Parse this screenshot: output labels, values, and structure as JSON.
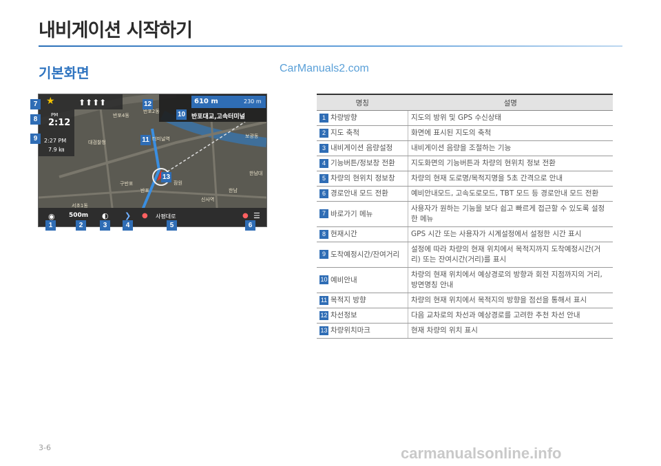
{
  "page": {
    "title": "내비게이션 시작하기",
    "section": "기본화면",
    "watermark_top": "CarManuals2.com",
    "page_number": "3-6",
    "watermark_bottom": "carmanualsonline.info"
  },
  "map": {
    "turn_distance": "610 m",
    "next_distance": "230 m",
    "guide_name": "반포대교,고속터미널",
    "time_pm": "PM",
    "current_time": "2:12",
    "arrival_time": "2:27 PM",
    "remaining_distance": "7.9 ㎞",
    "scale": "500m",
    "road_name": "사평대로",
    "labels": [
      "반포4동",
      "반포2동",
      "터미널역",
      "대검찰청",
      "구반포",
      "반포",
      "신사역",
      "한남",
      "한남대",
      "보광동",
      "서초1동",
      "잠원"
    ]
  },
  "callouts": [
    "1",
    "2",
    "3",
    "4",
    "5",
    "6",
    "7",
    "8",
    "9",
    "10",
    "11",
    "12",
    "13"
  ],
  "table": {
    "header": [
      "명칭",
      "설명"
    ],
    "rows": [
      {
        "num": "1",
        "name": "차량방향",
        "desc": "지도의 방위 및 GPS 수신상태"
      },
      {
        "num": "2",
        "name": "지도 축척",
        "desc": "화면에 표시된 지도의 축척"
      },
      {
        "num": "3",
        "name": "내비게이션 음량설정",
        "desc": "내비게이션 음량을 조절하는 기능"
      },
      {
        "num": "4",
        "name": "기능버튼/정보창 전환",
        "desc": "지도화면의 기능버튼과 차량의 현위치 정보 전환"
      },
      {
        "num": "5",
        "name": "차량의 현위치 정보창",
        "desc": "차량의 현재 도로명/목적지명을 5초 간격으로 안내"
      },
      {
        "num": "6",
        "name": "경로안내 모드 전환",
        "desc": "예비안내모드, 고속도로모드, TBT 모드 등 경로안내 모드 전환"
      },
      {
        "num": "7",
        "name": "바로가기 메뉴",
        "desc": "사용자가 원하는 기능을 보다 쉽고 빠르게 접근할 수 있도록 설정한 메뉴"
      },
      {
        "num": "8",
        "name": "현재시간",
        "desc": "GPS 시간 또는 사용자가 시계설정에서 설정한 시간 표시"
      },
      {
        "num": "9",
        "name": "도착예정시간/잔여거리",
        "desc": "설정에 따라 차량의 현재 위치에서 목적지까지 도착예정시간(거리) 또는 잔여시간(거리)를 표시"
      },
      {
        "num": "10",
        "name": "예비안내",
        "desc": "차량의 현재 위치에서 예상경로의 방향과 회전 지점까지의 거리, 방면명칭 안내"
      },
      {
        "num": "11",
        "name": "목적지 방향",
        "desc": "차량의 현재 위치에서 목적지의 방향을 점선을 통해서 표시"
      },
      {
        "num": "12",
        "name": "차선정보",
        "desc": "다음 교차로의 차선과 예상경로를 고려한 추천 차선 안내"
      },
      {
        "num": "13",
        "name": "차량위치마크",
        "desc": "현재 차량의 위치 표시"
      }
    ]
  }
}
